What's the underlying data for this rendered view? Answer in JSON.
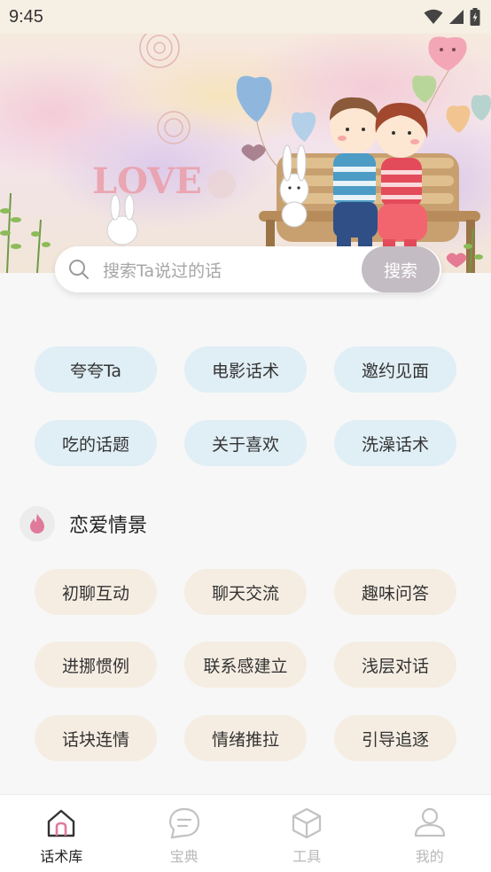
{
  "status_bar": {
    "time": "9:45"
  },
  "banner": {
    "text": "LOVE"
  },
  "search": {
    "placeholder": "搜索Ta说过的话",
    "button_label": "搜索"
  },
  "quick_topics": [
    "夸夸Ta",
    "电影话术",
    "邀约见面",
    "吃的话题",
    "关于喜欢",
    "洗澡话术"
  ],
  "love_section": {
    "title": "恋爱情景",
    "items": [
      "初聊互动",
      "聊天交流",
      "趣味问答",
      "进挪惯例",
      "联系感建立",
      "浅层对话",
      "话块连情",
      "情绪推拉",
      "引导追逐"
    ]
  },
  "bottom_nav": {
    "items": [
      {
        "label": "话术库",
        "icon": "home-icon",
        "active": true
      },
      {
        "label": "宝典",
        "icon": "chat-bubble-icon",
        "active": false
      },
      {
        "label": "工具",
        "icon": "cube-icon",
        "active": false
      },
      {
        "label": "我的",
        "icon": "user-icon",
        "active": false
      }
    ]
  },
  "colors": {
    "chip_blue": "#e0eef5",
    "chip_beige": "#f5ede2",
    "search_button": "#c4bcc3",
    "accent_pink": "#e07a9b",
    "nav_inactive": "#b9b9b9"
  }
}
